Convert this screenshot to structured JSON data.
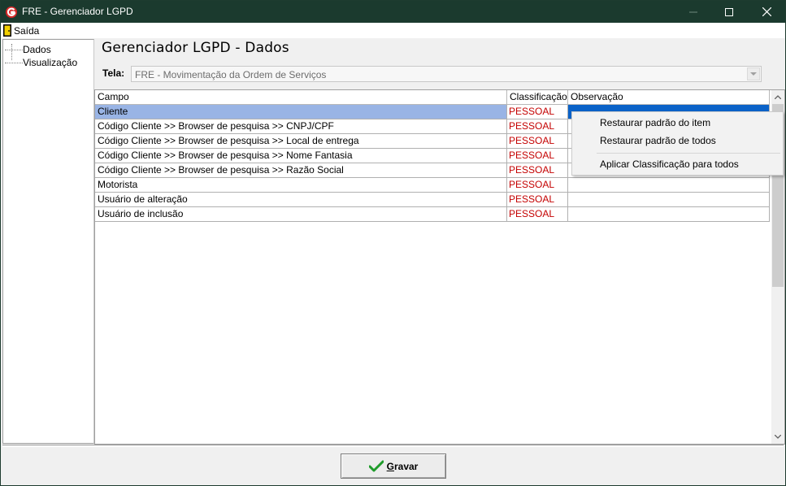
{
  "window": {
    "title": "FRE - Gerenciador LGPD"
  },
  "menu": {
    "exit_label": "Saída"
  },
  "tree": {
    "items": [
      "Dados",
      "Visualização"
    ]
  },
  "page": {
    "heading": "Gerenciador LGPD - Dados",
    "tela_label": "Tela:",
    "tela_value": "FRE - Movimentação da Ordem de Serviços"
  },
  "grid": {
    "columns": [
      "Campo",
      "Classificação",
      "Observação"
    ],
    "rows": [
      {
        "campo": "Cliente",
        "classificacao": "PESSOAL",
        "observacao": ""
      },
      {
        "campo": "Código Cliente >> Browser de pesquisa >> CNPJ/CPF",
        "classificacao": "PESSOAL",
        "observacao": ""
      },
      {
        "campo": "Código Cliente >> Browser de pesquisa >> Local de entrega",
        "classificacao": "PESSOAL",
        "observacao": ""
      },
      {
        "campo": "Código Cliente >> Browser de pesquisa >> Nome Fantasia",
        "classificacao": "PESSOAL",
        "observacao": ""
      },
      {
        "campo": "Código Cliente >> Browser de pesquisa >> Razão Social",
        "classificacao": "PESSOAL",
        "observacao": ""
      },
      {
        "campo": "Motorista",
        "classificacao": "PESSOAL",
        "observacao": ""
      },
      {
        "campo": "Usuário de alteração",
        "classificacao": "PESSOAL",
        "observacao": ""
      },
      {
        "campo": "Usuário de inclusão",
        "classificacao": "PESSOAL",
        "observacao": ""
      }
    ]
  },
  "context_menu": {
    "items": [
      "Restaurar padrão do item",
      "Restaurar padrão de todos",
      "Aplicar Classificação para todos"
    ]
  },
  "footer": {
    "save_label": "Gravar"
  },
  "colors": {
    "titlebar": "#1b3a2e",
    "classification_text": "#c40000",
    "selected_row": "#99b4e5",
    "selected_cell": "#0a62c8"
  }
}
